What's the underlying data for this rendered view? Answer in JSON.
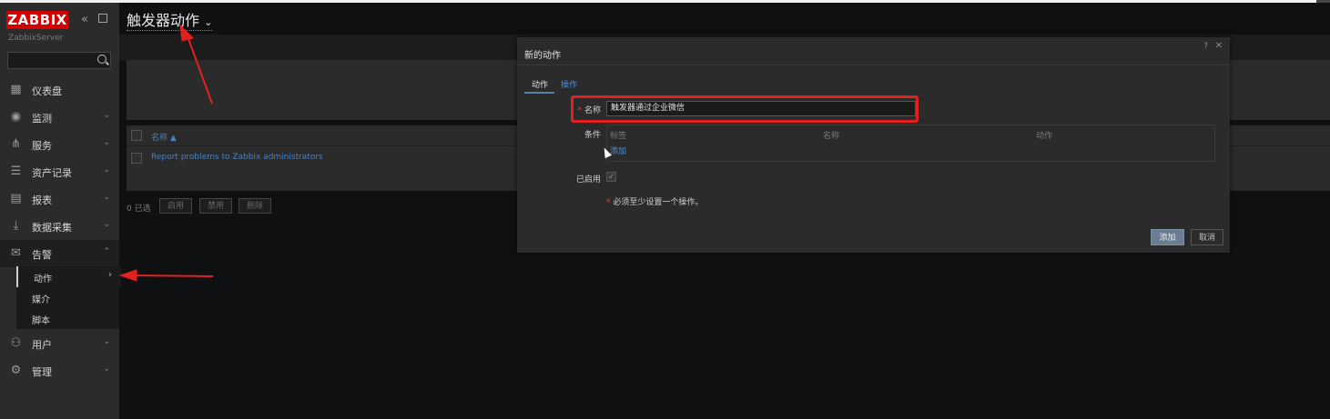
{
  "app": {
    "logo": "ZABBIX",
    "server": "ZabbixServer"
  },
  "sidebar": {
    "items": [
      {
        "label": "仪表盘",
        "icon": "dashboard-icon",
        "has_chevron": false
      },
      {
        "label": "监测",
        "icon": "eye-icon",
        "has_chevron": true
      },
      {
        "label": "服务",
        "icon": "services-icon",
        "has_chevron": true
      },
      {
        "label": "资产记录",
        "icon": "list-icon",
        "has_chevron": true
      },
      {
        "label": "报表",
        "icon": "report-icon",
        "has_chevron": true
      },
      {
        "label": "数据采集",
        "icon": "download-icon",
        "has_chevron": true
      },
      {
        "label": "告警",
        "icon": "mail-icon",
        "has_chevron": true,
        "expanded": true
      },
      {
        "label": "用户",
        "icon": "users-icon",
        "has_chevron": true
      },
      {
        "label": "管理",
        "icon": "gear-icon",
        "has_chevron": true
      }
    ],
    "subitems": [
      {
        "label": "动作",
        "active": true
      },
      {
        "label": "媒介"
      },
      {
        "label": "脚本"
      }
    ]
  },
  "page": {
    "title": "触发器动作",
    "table": {
      "col_name": "名称 ▲",
      "rows": [
        "Report problems to Zabbix administrators"
      ]
    },
    "footer": {
      "selected": "0 已选",
      "buttons": [
        "启用",
        "禁用",
        "删除"
      ]
    }
  },
  "modal": {
    "title": "新的动作",
    "tabs": [
      "动作",
      "操作"
    ],
    "name_label": "名称",
    "name_value": "触发器通过企业微信",
    "conditions_label": "条件",
    "cond_headers": [
      "标签",
      "名称",
      "动作"
    ],
    "cond_add": "添加",
    "enabled_label": "已启用",
    "warning": "必须至少设置一个操作。",
    "btn_add": "添加",
    "btn_cancel": "取消",
    "help": "?",
    "close": "✕"
  },
  "colors": {
    "logo_bg": "#d40000",
    "link": "#4f7fb8",
    "highlight": "#e32020",
    "primary_button": "#6b7d91"
  }
}
